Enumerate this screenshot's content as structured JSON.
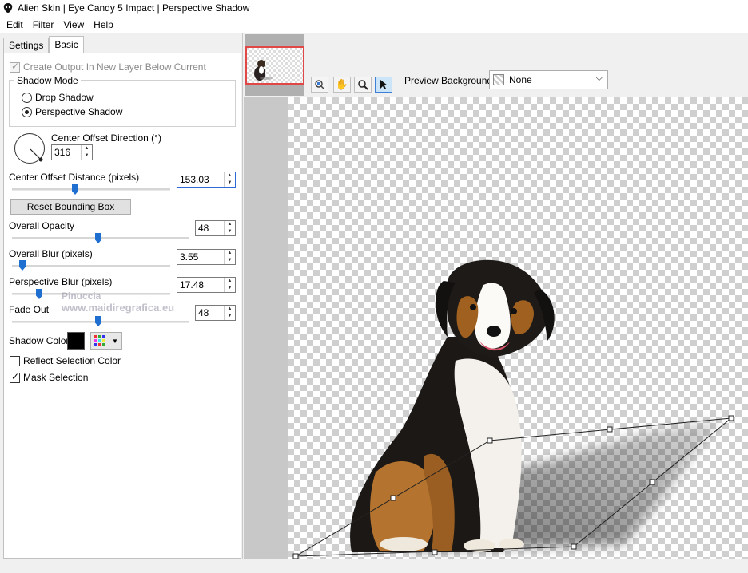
{
  "window": {
    "title": "Alien Skin | Eye Candy 5 Impact | Perspective Shadow"
  },
  "menu": [
    "Edit",
    "Filter",
    "View",
    "Help"
  ],
  "tabs": {
    "settings": "Settings",
    "basic": "Basic"
  },
  "options": {
    "create_output": {
      "label": "Create Output In New Layer Below Current",
      "checked": true,
      "enabled": false
    },
    "shadow_mode": {
      "title": "Shadow Mode",
      "drop": {
        "label": "Drop Shadow",
        "selected": false
      },
      "perspective": {
        "label": "Perspective Shadow",
        "selected": true
      }
    },
    "center_offset_direction": {
      "label": "Center Offset Direction (°)",
      "value": "316",
      "angle": 316
    },
    "center_offset_distance": {
      "label": "Center Offset Distance (pixels)",
      "value": "153.03",
      "slider": 0.41
    },
    "reset_bounding_box": "Reset Bounding Box",
    "overall_opacity": {
      "label": "Overall Opacity",
      "value": "48",
      "slider": 0.48
    },
    "overall_blur": {
      "label": "Overall Blur (pixels)",
      "value": "3.55",
      "slider": 0.05
    },
    "perspective_blur": {
      "label": "Perspective Blur (pixels)",
      "value": "17.48",
      "slider": 0.18
    },
    "fade_out": {
      "label": "Fade Out",
      "value": "48",
      "slider": 0.48
    },
    "shadow_color": {
      "label": "Shadow Color",
      "color": "#000000"
    },
    "reflect_selection_color": {
      "label": "Reflect Selection Color",
      "checked": false
    },
    "mask_selection": {
      "label": "Mask Selection",
      "checked": true
    }
  },
  "watermark": {
    "line1": "Pinuccia",
    "line2": "www.maidiregrafica.eu"
  },
  "preview": {
    "background_label": "Preview Background:",
    "background_value": "None",
    "tools": [
      "navigator-icon",
      "hand-icon",
      "zoom-icon",
      "pointer-icon"
    ]
  },
  "colors": {
    "accent": "#1f6fd1",
    "thumb_border": "#e04848"
  }
}
